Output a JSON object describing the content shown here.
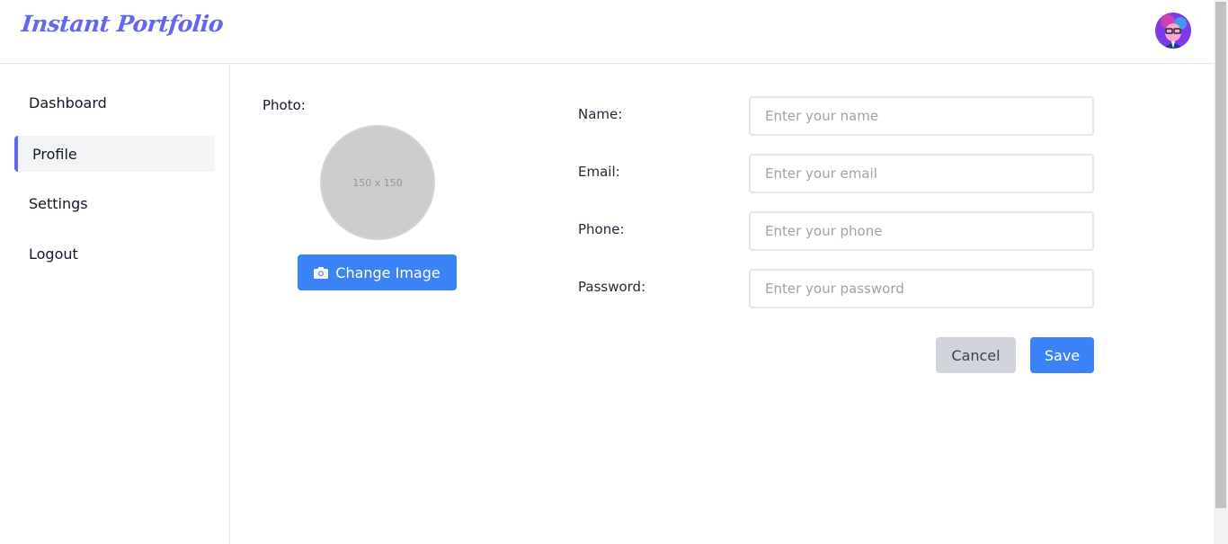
{
  "header": {
    "logo_text": "Instant Portfolio",
    "avatar_icon": "user-avatar"
  },
  "sidebar": {
    "items": [
      {
        "label": "Dashboard"
      },
      {
        "label": "Profile",
        "active": true
      },
      {
        "label": "Settings"
      },
      {
        "label": "Logout"
      }
    ]
  },
  "photo": {
    "label": "Photo:",
    "placeholder_text": "150 x 150",
    "change_button_label": "Change Image",
    "change_button_icon": "camera-icon"
  },
  "form": {
    "fields": [
      {
        "label": "Name:",
        "placeholder": "Enter your name",
        "value": ""
      },
      {
        "label": "Email:",
        "placeholder": "Enter your email",
        "value": ""
      },
      {
        "label": "Phone:",
        "placeholder": "Enter your phone",
        "value": ""
      },
      {
        "label": "Password:",
        "placeholder": "Enter your password",
        "value": ""
      }
    ],
    "cancel_label": "Cancel",
    "save_label": "Save"
  },
  "colors": {
    "brand": "#6366f1",
    "primary": "#3b82f6",
    "secondary": "#d1d5db"
  }
}
